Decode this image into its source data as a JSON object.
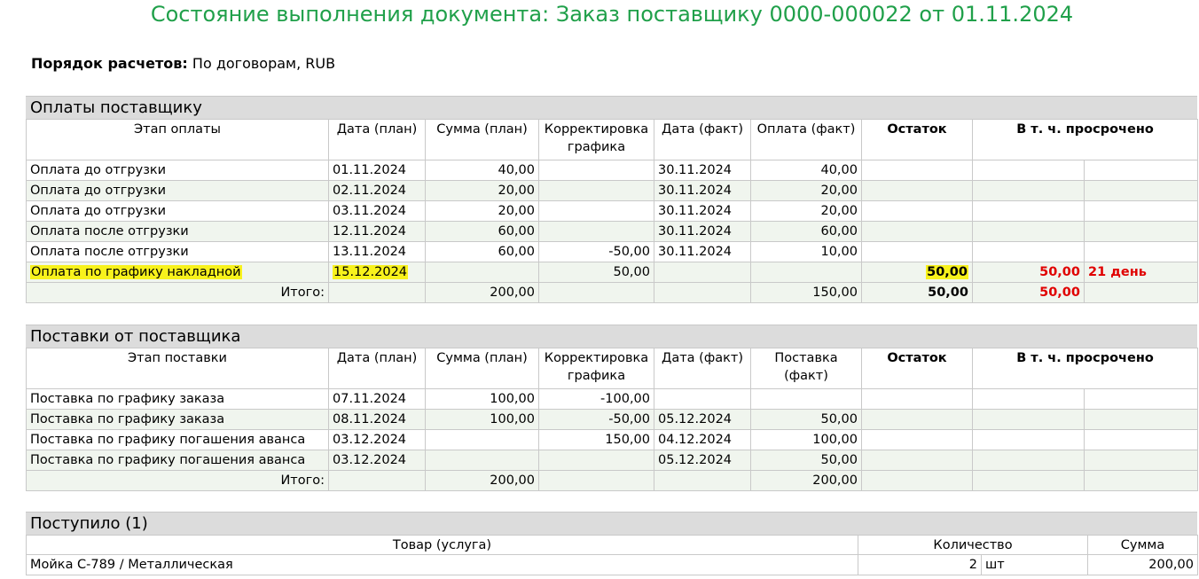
{
  "title": "Состояние выполнения документа: Заказ поставщику 0000-000022 от 01.11.2024",
  "settlement": {
    "label": "Порядок расчетов:",
    "value": "По договорам, RUB"
  },
  "payments": {
    "heading": "Оплаты поставщику",
    "columns": [
      "Этап оплаты",
      "Дата (план)",
      "Сумма (план)",
      "Корректировка графика",
      "Дата (факт)",
      "Оплата (факт)",
      "Остаток",
      "В т. ч. просрочено"
    ],
    "rows": [
      {
        "stage": "Оплата до отгрузки",
        "date_plan": "01.11.2024",
        "sum_plan": "40,00",
        "correction": "",
        "date_fact": "30.11.2024",
        "fact": "40,00",
        "rest": "",
        "overdue": "",
        "days": ""
      },
      {
        "stage": "Оплата до отгрузки",
        "date_plan": "02.11.2024",
        "sum_plan": "20,00",
        "correction": "",
        "date_fact": "30.11.2024",
        "fact": "20,00",
        "rest": "",
        "overdue": "",
        "days": ""
      },
      {
        "stage": "Оплата до отгрузки",
        "date_plan": "03.11.2024",
        "sum_plan": "20,00",
        "correction": "",
        "date_fact": "30.11.2024",
        "fact": "20,00",
        "rest": "",
        "overdue": "",
        "days": ""
      },
      {
        "stage": "Оплата после отгрузки",
        "date_plan": "12.11.2024",
        "sum_plan": "60,00",
        "correction": "",
        "date_fact": "30.11.2024",
        "fact": "60,00",
        "rest": "",
        "overdue": "",
        "days": ""
      },
      {
        "stage": "Оплата после отгрузки",
        "date_plan": "13.11.2024",
        "sum_plan": "60,00",
        "correction": "-50,00",
        "date_fact": "30.11.2024",
        "fact": "10,00",
        "rest": "",
        "overdue": "",
        "days": ""
      },
      {
        "stage": "Оплата по графику накладной",
        "date_plan": "15.12.2024",
        "sum_plan": "",
        "correction": "50,00",
        "date_fact": "",
        "fact": "",
        "rest": "50,00",
        "overdue": "50,00",
        "days": "21 день"
      }
    ],
    "total": {
      "label": "Итого:",
      "sum_plan": "200,00",
      "fact": "150,00",
      "rest": "50,00",
      "overdue": "50,00"
    }
  },
  "deliveries": {
    "heading": "Поставки от поставщика",
    "columns": [
      "Этап поставки",
      "Дата (план)",
      "Сумма (план)",
      "Корректировка графика",
      "Дата (факт)",
      "Поставка (факт)",
      "Остаток",
      "В т. ч. просрочено"
    ],
    "rows": [
      {
        "stage": "Поставка по графику заказа",
        "date_plan": "07.11.2024",
        "sum_plan": "100,00",
        "correction": "-100,00",
        "date_fact": "",
        "fact": ""
      },
      {
        "stage": "Поставка по графику заказа",
        "date_plan": "08.11.2024",
        "sum_plan": "100,00",
        "correction": "-50,00",
        "date_fact": "05.12.2024",
        "fact": "50,00"
      },
      {
        "stage": "Поставка по графику погашения аванса",
        "date_plan": "03.12.2024",
        "sum_plan": "",
        "correction": "150,00",
        "date_fact": "04.12.2024",
        "fact": "100,00"
      },
      {
        "stage": "Поставка по графику погашения аванса",
        "date_plan": "03.12.2024",
        "sum_plan": "",
        "correction": "",
        "date_fact": "05.12.2024",
        "fact": "50,00"
      }
    ],
    "total": {
      "label": "Итого:",
      "sum_plan": "200,00",
      "fact": "200,00"
    }
  },
  "received": {
    "heading": "Поступило (1)",
    "columns": [
      "Товар (услуга)",
      "Количество",
      "Сумма"
    ],
    "rows": [
      {
        "item": "Мойка С-789 / Металлическая",
        "qty": "2",
        "unit": "шт",
        "sum": "200,00"
      }
    ]
  },
  "colors": {
    "title": "#20a04a",
    "overdue": "#e00000",
    "highlight": "#f8f21c",
    "row_shade": "#f0f5ee"
  }
}
